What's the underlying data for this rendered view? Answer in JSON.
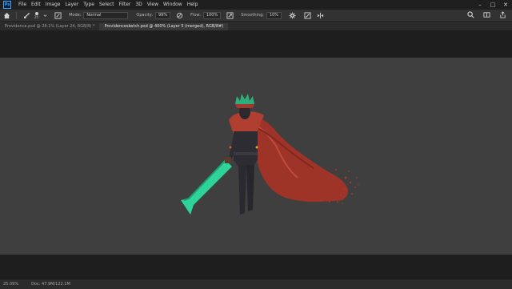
{
  "app": {
    "logo_text": "Ps"
  },
  "menu": {
    "items": [
      "File",
      "Edit",
      "Image",
      "Layer",
      "Type",
      "Select",
      "Filter",
      "3D",
      "View",
      "Window",
      "Help"
    ]
  },
  "window_controls": {
    "minimize": "–",
    "maximize": "□",
    "close": "✕"
  },
  "options_bar": {
    "brush_size": "25",
    "mode_label": "Mode:",
    "mode_value": "Normal",
    "opacity_label": "Opacity:",
    "opacity_value": "99%",
    "flow_label": "Flow:",
    "flow_value": "100%",
    "smoothing_label": "Smoothing:",
    "smoothing_value": "10%"
  },
  "tabs": [
    {
      "title": "Providence.psd @ 28.1% (Layer 24, RGB/8) *",
      "active": false
    },
    {
      "title": "Providencesketch.psd @ 400% (Layer 5 (merged), RGB/8#)",
      "active": true
    }
  ],
  "status": {
    "zoom": "25.09%",
    "doc": "Doc: 47.9M/122.1M"
  },
  "colors": {
    "accent": "#31a8ff",
    "canvas": "#3f3f3f",
    "cape": "#a5382d",
    "sword": "#2ed39a"
  }
}
